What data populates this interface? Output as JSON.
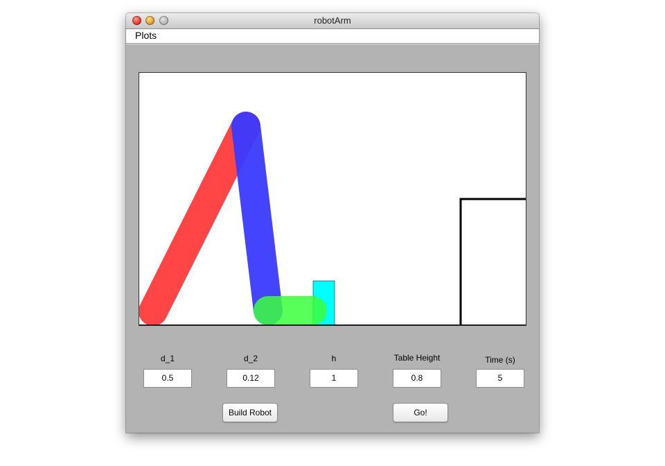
{
  "window": {
    "title": "robotArm"
  },
  "menubar": {
    "items": [
      {
        "label": "Plots"
      }
    ]
  },
  "controls": {
    "fields": [
      {
        "label": "d_1",
        "value": "0.5"
      },
      {
        "label": "d_2",
        "value": "0.12"
      },
      {
        "label": "h",
        "value": "1"
      },
      {
        "label": "Table Height",
        "value": "0.8"
      },
      {
        "label": "Time (s)",
        "value": "5"
      }
    ],
    "buttons": {
      "build_label": "Build Robot",
      "go_label": "Go!"
    }
  },
  "plot": {
    "link_colors": {
      "link1": "#ff3b3b",
      "link2": "#3a3aff",
      "gripper": "#3cff3c",
      "block": "#00ffff",
      "table": "#000000"
    }
  }
}
